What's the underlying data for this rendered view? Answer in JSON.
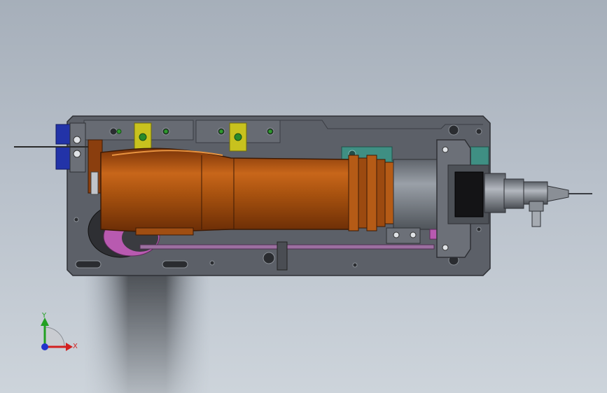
{
  "triad": {
    "x_label": "X",
    "y_label": "Y"
  },
  "colors": {
    "background_top": "#a6afba",
    "background_bottom": "#cdd4db",
    "plate": "#5c6068",
    "plate_edge": "#3a3d43",
    "motor_body": "#9c4a10",
    "motor_highlight": "#c8661a",
    "bracket_yellow": "#c8c21e",
    "clamp_blue": "#2233a8",
    "green_plate": "#3f8f83",
    "spindle_grey": "#7f858d",
    "axis_x": "#d22020",
    "axis_y": "#22a022",
    "axis_z": "#2233cc"
  }
}
